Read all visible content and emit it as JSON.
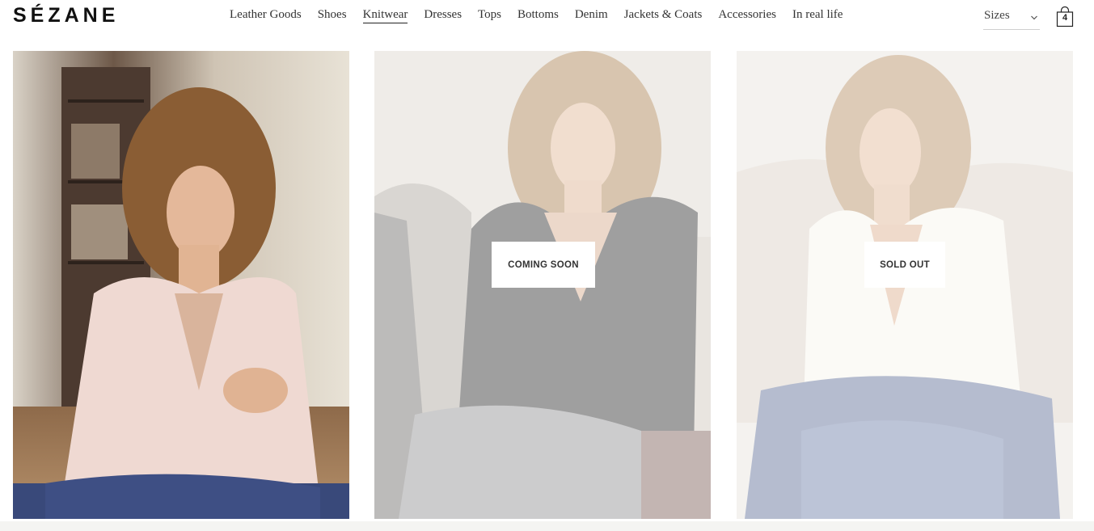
{
  "brand": {
    "logo": "SÉZANE"
  },
  "nav": {
    "items": [
      {
        "label": "Leather Goods",
        "active": false
      },
      {
        "label": "Shoes",
        "active": false
      },
      {
        "label": "Knitwear",
        "active": true
      },
      {
        "label": "Dresses",
        "active": false
      },
      {
        "label": "Tops",
        "active": false
      },
      {
        "label": "Bottoms",
        "active": false
      },
      {
        "label": "Denim",
        "active": false
      },
      {
        "label": "Jackets & Coats",
        "active": false
      },
      {
        "label": "Accessories",
        "active": false
      },
      {
        "label": "In real life",
        "active": false
      }
    ]
  },
  "filters": {
    "sizes_label": "Sizes"
  },
  "cart": {
    "count": "4"
  },
  "products": [
    {
      "status": "",
      "sweater_color": "#efd9d2",
      "background": "#b8a48e"
    },
    {
      "status": "COMING SOON",
      "sweater_color": "#2a2a2c",
      "background": "#e9e5df"
    },
    {
      "status": "SOLD OUT",
      "sweater_color": "#f4f0ea",
      "background": "#e8e4de"
    }
  ]
}
